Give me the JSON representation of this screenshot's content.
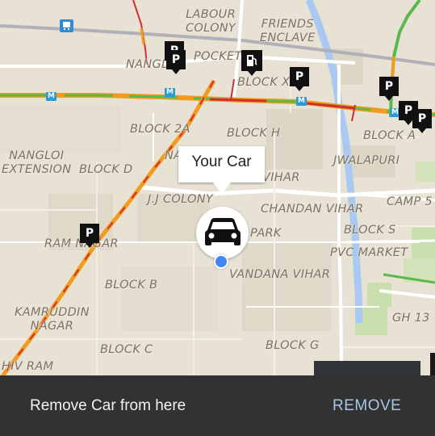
{
  "map": {
    "labels": {
      "labour_colony": [
        "LABOUR",
        "COLONY"
      ],
      "friends_enclave": [
        "FRIENDS",
        "ENCLAVE"
      ],
      "nangl": "NANGL",
      "pocket": "POCKET",
      "block_x": "BLOCK X",
      "block_2a": "BLOCK 2A",
      "block_h": "BLOCK H",
      "block_a": "BLOCK A",
      "nangloi_extension": [
        "NANGLOI",
        "EXTENSION"
      ],
      "block_d": "BLOCK D",
      "na": "NA",
      "vihar": "VIHAR",
      "jwalapuri": "JWALAPURI",
      "jj_colony": "J.J COLONY",
      "chandan_vihar": "CHANDAN VIHAR",
      "camp5": "CAMP 5",
      "block_s": "BLOCK S",
      "ram_nagar": "RAM NAGAR",
      "park": "PARK",
      "pvc_market": "PVC MARKET",
      "block_b": "BLOCK B",
      "vandana_vihar": "VANDANA VIHAR",
      "kamruddin_nagar": [
        "KAMRUDDIN",
        "NAGAR"
      ],
      "gh13": "GH 13",
      "block_c": "BLOCK C",
      "block_g": "BLOCK G",
      "hiv_ram": "HIV RAM"
    },
    "parking_glyph": "P",
    "metro_glyph": "M",
    "colors": {
      "land": "#e8e2d5",
      "block": "#ddd6c6",
      "water": "#a9c9f2",
      "road": "#ffffff",
      "metro_line": "#b0b0b8",
      "traffic_green": "#5ab94e",
      "traffic_orange": "#f29b1d",
      "traffic_red": "#d22f2a",
      "park": "#c9dfae",
      "accent_blue": "#4186f3"
    }
  },
  "car_marker": {
    "callout_label": "Your Car",
    "icon": "car-icon"
  },
  "snackbar": {
    "message": "Remove Car from here",
    "action_label": "REMOVE"
  }
}
